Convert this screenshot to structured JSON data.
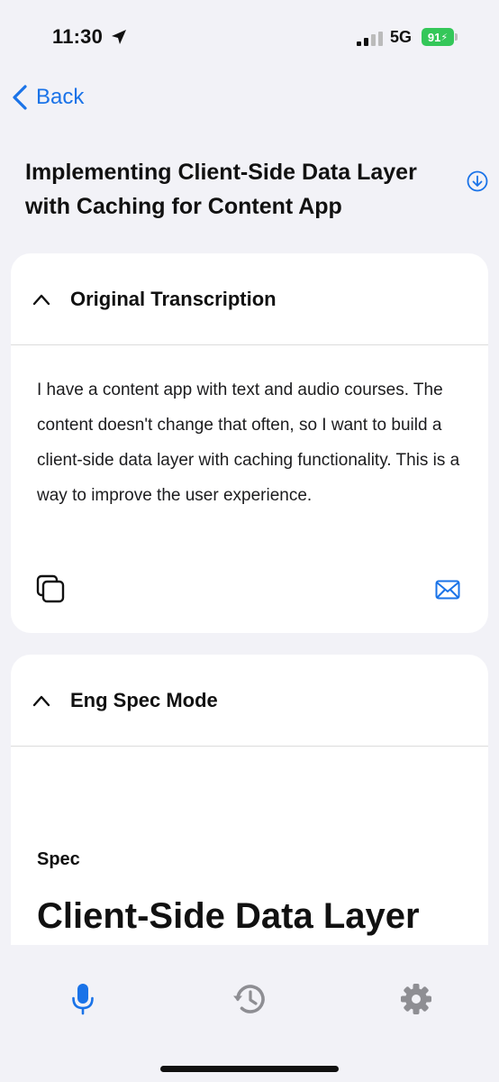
{
  "status_bar": {
    "time": "11:30",
    "network": "5G",
    "battery": "91"
  },
  "nav": {
    "back_label": "Back"
  },
  "page": {
    "title": "Implementing Client-Side Data Layer with Caching for Content App"
  },
  "transcription_card": {
    "title": "Original Transcription",
    "text": "I have a content app with text and audio courses. The content doesn't change that often, so I want to build a client-side data layer with caching functionality. This is a way to improve the user experience."
  },
  "spec_card": {
    "title": "Eng Spec Mode",
    "label": "Spec",
    "heading": "Client-Side Data Layer"
  },
  "tab_bar": {
    "tabs": [
      {
        "icon": "microphone-icon",
        "active": true
      },
      {
        "icon": "history-icon",
        "active": false
      },
      {
        "icon": "gear-icon",
        "active": false
      }
    ]
  },
  "colors": {
    "accent": "#1a73e8",
    "battery": "#34c759",
    "background": "#f2f2f7",
    "inactive_icon": "#8e8e93"
  }
}
